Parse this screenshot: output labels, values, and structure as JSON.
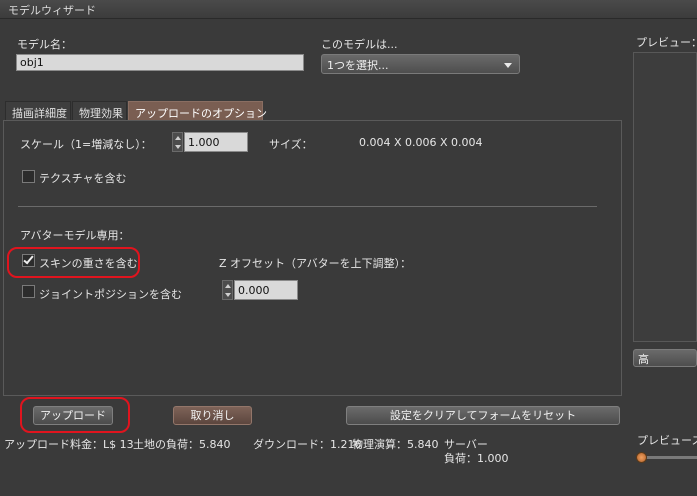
{
  "window": {
    "title": "モデルウィザード"
  },
  "model": {
    "name_label": "モデル名：",
    "name_value": "obj1",
    "this_model_label": "このモデルは...",
    "select_value": "1つを選択..."
  },
  "tabs": [
    {
      "label": "描画詳細度"
    },
    {
      "label": "物理効果"
    },
    {
      "label": "アップロードのオプション"
    }
  ],
  "upload_options": {
    "scale_label": "スケール（1=増減なし）：",
    "scale_value": "1.000",
    "size_label": "サイズ：",
    "size_value": "0.004 X 0.006 X 0.004",
    "include_textures_label": "テクスチャを含む",
    "include_textures_checked": false,
    "avatar_section_label": "アバターモデル専用：",
    "skin_weights_label": "スキンの重さを含む",
    "skin_weights_checked": true,
    "joint_positions_label": "ジョイントポジションを含む",
    "joint_positions_checked": false,
    "z_offset_label": "Z オフセット（アバターを上下調整）：",
    "z_offset_value": "0.000"
  },
  "buttons": {
    "upload": "アップロード",
    "cancel": "取り消し",
    "reset": "設定をクリアしてフォームをリセット"
  },
  "footer": {
    "upload_fee": "アップロード料金：L$ 13",
    "land_impact": "土地の負荷：5.840",
    "download": "ダウンロード：1.216",
    "physics": "物理演算：5.840",
    "server_label": "サーバー",
    "server_value": "負荷：1.000"
  },
  "preview": {
    "label": "プレビュー：",
    "quality_value": "高",
    "slider_label": "プレビュース"
  },
  "colors": {
    "active_tab": "#7a5e52",
    "highlight": "#e0141e"
  }
}
